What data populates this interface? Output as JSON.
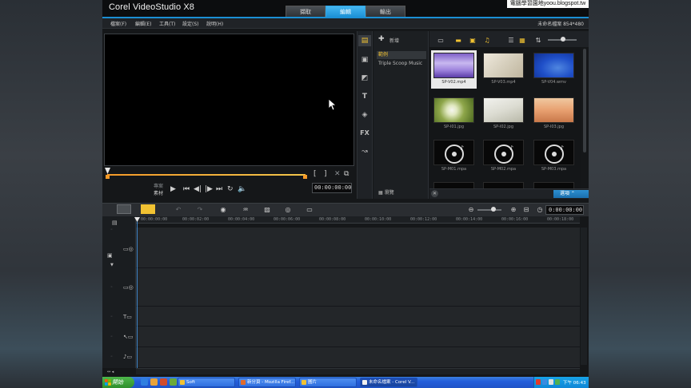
{
  "app": {
    "title": "Corel VideoStudio X8",
    "tabs": [
      "擷取",
      "編輯",
      "輸出"
    ],
    "watermark": "電腦學習園地yoou.blogspot.tw",
    "project_info": "未命名檔案 854*480"
  },
  "menu": [
    "檔案(F)",
    "編輯(E)",
    "工具(T)",
    "設定(S)",
    "說明(H)"
  ],
  "preview": {
    "mode_project": "專案",
    "mode_clip": "素材",
    "timecode": "00:00:00:00"
  },
  "library": {
    "add_label": "新增",
    "folders": [
      "範例",
      "Triple Scoop Music"
    ],
    "browse_label": "瀏覽",
    "options_label": "選項",
    "media": [
      "SP-V02.mp4",
      "SP-V03.mp4",
      "SP-V04.wmv",
      "SP-I01.jpg",
      "SP-I02.jpg",
      "SP-I03.jpg",
      "SP-M01.mpa",
      "SP-M02.mpa",
      "SP-M03.mpa"
    ]
  },
  "timeline": {
    "timecode": "0:00:00:00",
    "ruler": [
      "00:00:00:00",
      "00:00:02:00",
      "00:00:04:00",
      "00:00:06:00",
      "00:00:08:00",
      "00:00:10:00",
      "00:00:12:00",
      "00:00:14:00",
      "00:00:16:00",
      "00:00:18:00"
    ]
  },
  "taskbar": {
    "start_label": "開始",
    "items": [
      "Soft",
      "新分頁 - Mozilla Firef...",
      "圖片",
      "未命名檔案 - Corel V..."
    ],
    "clock": "下午 06:43"
  },
  "colors": {
    "accent_blue": "#1b8fd4",
    "selection_yellow": "#f1c232",
    "trim_orange": "#f59a28"
  }
}
